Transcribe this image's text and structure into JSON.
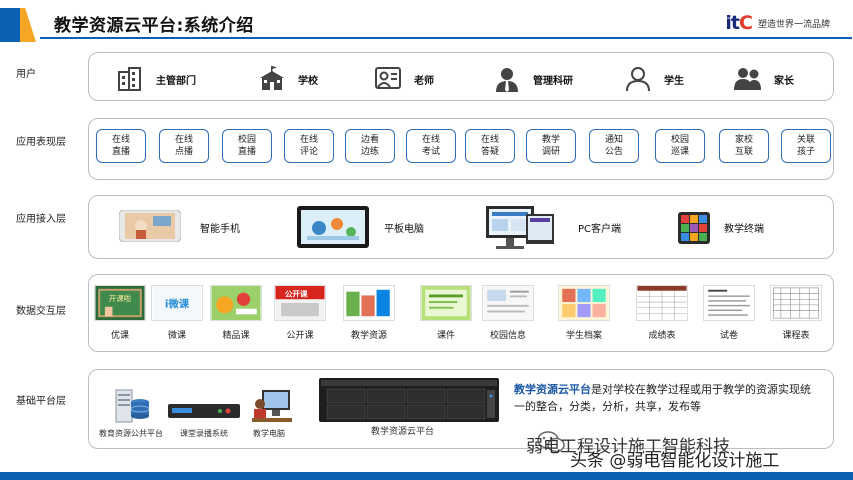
{
  "header": {
    "title": "教学资源云平台:系统介绍",
    "brand_logo_main": "it",
    "brand_logo_dot": "C",
    "brand_slogan": "塑造世界一流品牌"
  },
  "layers": {
    "users": {
      "label": "用户",
      "items": [
        {
          "label": "主管部门",
          "icon": "building-icon"
        },
        {
          "label": "学校",
          "icon": "school-icon"
        },
        {
          "label": "老师",
          "icon": "teacher-icon"
        },
        {
          "label": "管理科研",
          "icon": "manager-icon"
        },
        {
          "label": "学生",
          "icon": "student-icon"
        },
        {
          "label": "家长",
          "icon": "parents-icon"
        }
      ]
    },
    "apps": {
      "label": "应用表现层",
      "items": [
        "在线\n直播",
        "在线\n点播",
        "校园\n直播",
        "在线\n评论",
        "边看\n边练",
        "在线\n考试",
        "在线\n答疑",
        "教学\n调研",
        "通知\n公告",
        "校园\n巡课",
        "家校\n互联",
        "关联\n孩子"
      ]
    },
    "access": {
      "label": "应用接入层",
      "items": [
        "智能手机",
        "平板电脑",
        "PC客户端",
        "教学终端"
      ]
    },
    "data": {
      "label": "数据交互层",
      "items": [
        "优课",
        "微课",
        "精品课",
        "公开课",
        "教学资源",
        "课件",
        "校园信息",
        "学生档案",
        "成绩表",
        "试卷",
        "课程表"
      ],
      "thumb_texts": {
        "youke": "开课啦",
        "weike": "i微课",
        "gongkai": "公开课"
      }
    },
    "base": {
      "label": "基础平台层",
      "items": [
        "教育资源公共平台",
        "课堂录播系统",
        "教学电脑",
        "教学资源云平台"
      ],
      "desc_highlight": "教学资源云平台",
      "desc_rest": "是对学校在教学过程或用于教学的资源实现统一的整合，分类，分析，共享，发布等"
    }
  },
  "watermark": {
    "line1": "弱电工程设计施工智能科技",
    "line2": "头条 @弱电智能化设计施工"
  },
  "colors": {
    "accent": "#0d5fb3",
    "chip_border": "#2f6fb5",
    "highlight": "#1c58a6",
    "orange": "#f5a623"
  }
}
